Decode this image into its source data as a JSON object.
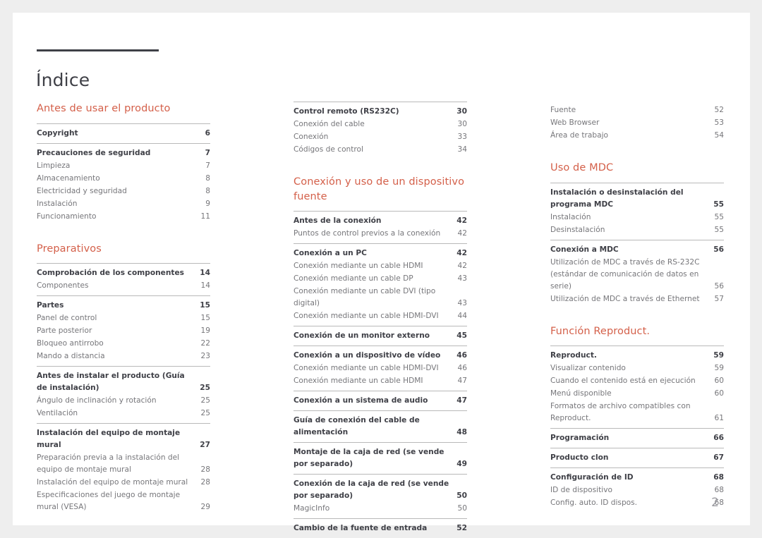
{
  "document": {
    "title": "Índice",
    "folio": "2",
    "accent_color": "#d4604a",
    "text_color": "#3f4047",
    "sub_text_color": "#76767a",
    "rule_color": "#b9b9b9",
    "page_background": "#ffffff",
    "canvas_background": "#eeeeee"
  },
  "columns": [
    {
      "name": "column-1",
      "blocks": [
        {
          "type": "heading",
          "text": "Antes de usar el producto",
          "pad_top": false
        },
        {
          "type": "group",
          "rule": true,
          "rows": [
            {
              "label": "Copyright",
              "page": "6",
              "major": true
            }
          ]
        },
        {
          "type": "group",
          "rule": true,
          "rows": [
            {
              "label": "Precauciones de seguridad",
              "page": "7",
              "major": true
            },
            {
              "label": "Limpieza",
              "page": "7",
              "major": false
            },
            {
              "label": "Almacenamiento",
              "page": "8",
              "major": false
            },
            {
              "label": "Electricidad y seguridad",
              "page": "8",
              "major": false
            },
            {
              "label": "Instalación",
              "page": "9",
              "major": false
            },
            {
              "label": "Funcionamiento",
              "page": "11",
              "major": false
            }
          ]
        },
        {
          "type": "heading",
          "text": "Preparativos",
          "pad_top": true
        },
        {
          "type": "group",
          "rule": true,
          "rows": [
            {
              "label": "Comprobación de los componentes",
              "page": "14",
              "major": true
            },
            {
              "label": "Componentes",
              "page": "14",
              "major": false
            }
          ]
        },
        {
          "type": "group",
          "rule": true,
          "rows": [
            {
              "label": "Partes",
              "page": "15",
              "major": true
            },
            {
              "label": "Panel de control",
              "page": "15",
              "major": false
            },
            {
              "label": "Parte posterior",
              "page": "19",
              "major": false
            },
            {
              "label": "Bloqueo antirrobo",
              "page": "22",
              "major": false
            },
            {
              "label": "Mando a distancia",
              "page": "23",
              "major": false
            }
          ]
        },
        {
          "type": "group",
          "rule": true,
          "rows": [
            {
              "label": "Antes de instalar el producto (Guía de instalación)",
              "page": "25",
              "major": true
            },
            {
              "label": "Ángulo de inclinación y rotación",
              "page": "25",
              "major": false
            },
            {
              "label": "Ventilación",
              "page": "25",
              "major": false
            }
          ]
        },
        {
          "type": "group",
          "rule": true,
          "rows": [
            {
              "label": "Instalación del equipo de montaje mural",
              "page": "27",
              "major": true
            },
            {
              "label": "Preparación previa a la instalación del equipo de montaje mural",
              "page": "28",
              "major": false
            },
            {
              "label": "Instalación del equipo de montaje mural",
              "page": "28",
              "major": false
            },
            {
              "label": "Especificaciones del juego de montaje mural (VESA)",
              "page": "29",
              "major": false
            }
          ]
        }
      ]
    },
    {
      "name": "column-2",
      "blocks": [
        {
          "type": "group",
          "rule": true,
          "rows": [
            {
              "label": "Control remoto (RS232C)",
              "page": "30",
              "major": true
            },
            {
              "label": "Conexión del cable",
              "page": "30",
              "major": false
            },
            {
              "label": "Conexión",
              "page": "33",
              "major": false
            },
            {
              "label": "Códigos de control",
              "page": "34",
              "major": false
            }
          ]
        },
        {
          "type": "heading",
          "text": "Conexión y uso de un dispositivo fuente",
          "pad_top": true
        },
        {
          "type": "group",
          "rule": true,
          "rows": [
            {
              "label": "Antes de la conexión",
              "page": "42",
              "major": true
            },
            {
              "label": "Puntos de control previos a la conexión",
              "page": "42",
              "major": false
            }
          ]
        },
        {
          "type": "group",
          "rule": true,
          "rows": [
            {
              "label": "Conexión a un PC",
              "page": "42",
              "major": true
            },
            {
              "label": "Conexión mediante un cable HDMI",
              "page": "42",
              "major": false
            },
            {
              "label": "Conexión mediante un cable DP",
              "page": "43",
              "major": false
            },
            {
              "label": "Conexión mediante un cable DVI (tipo digital)",
              "page": "43",
              "major": false,
              "wide": true
            },
            {
              "label": "Conexión mediante un cable HDMI-DVI",
              "page": "44",
              "major": false
            }
          ]
        },
        {
          "type": "group",
          "rule": true,
          "rows": [
            {
              "label": "Conexión de un monitor externo",
              "page": "45",
              "major": true
            }
          ]
        },
        {
          "type": "group",
          "rule": true,
          "rows": [
            {
              "label": "Conexión a un dispositivo de vídeo",
              "page": "46",
              "major": true
            },
            {
              "label": "Conexión mediante un cable HDMI-DVI",
              "page": "46",
              "major": false
            },
            {
              "label": "Conexión mediante un cable HDMI",
              "page": "47",
              "major": false
            }
          ]
        },
        {
          "type": "group",
          "rule": true,
          "rows": [
            {
              "label": "Conexión a un sistema de audio",
              "page": "47",
              "major": true
            }
          ]
        },
        {
          "type": "group",
          "rule": true,
          "rows": [
            {
              "label": "Guía de conexión del cable de alimentación",
              "page": "48",
              "major": true,
              "wide": true
            }
          ]
        },
        {
          "type": "group",
          "rule": true,
          "rows": [
            {
              "label": "Montaje de la caja de red (se vende por separado)",
              "page": "49",
              "major": true
            }
          ]
        },
        {
          "type": "group",
          "rule": true,
          "rows": [
            {
              "label": "Conexión de la caja de red (se vende por separado)",
              "page": "50",
              "major": true
            },
            {
              "label": "MagicInfo",
              "page": "50",
              "major": false
            }
          ]
        },
        {
          "type": "group",
          "rule": true,
          "rows": [
            {
              "label": "Cambio de la fuente de entrada",
              "page": "52",
              "major": true
            }
          ]
        }
      ]
    },
    {
      "name": "column-3",
      "blocks": [
        {
          "type": "group",
          "rule": false,
          "rows": [
            {
              "label": "Fuente",
              "page": "52",
              "major": false
            },
            {
              "label": "Web Browser",
              "page": "53",
              "major": false
            },
            {
              "label": "Área de trabajo",
              "page": "54",
              "major": false
            }
          ]
        },
        {
          "type": "heading",
          "text": "Uso de MDC",
          "pad_top": true
        },
        {
          "type": "group",
          "rule": true,
          "rows": [
            {
              "label": "Instalación o desinstalación del programa MDC",
              "page": "55",
              "major": true
            },
            {
              "label": "Instalación",
              "page": "55",
              "major": false
            },
            {
              "label": "Desinstalación",
              "page": "55",
              "major": false
            }
          ]
        },
        {
          "type": "group",
          "rule": true,
          "rows": [
            {
              "label": "Conexión a MDC",
              "page": "56",
              "major": true
            },
            {
              "label": "Utilización de MDC a través de RS-232C (estándar de comunicación de datos en serie)",
              "page": "56",
              "major": false
            },
            {
              "label": "Utilización de MDC a través de Ethernet",
              "page": "57",
              "major": false
            }
          ]
        },
        {
          "type": "heading",
          "text": "Función Reproduct.",
          "pad_top": true
        },
        {
          "type": "group",
          "rule": true,
          "rows": [
            {
              "label": "Reproduct.",
              "page": "59",
              "major": true
            },
            {
              "label": "Visualizar contenido",
              "page": "59",
              "major": false
            },
            {
              "label": "Cuando el contenido está en ejecución",
              "page": "60",
              "major": false
            },
            {
              "label": "Menú disponible",
              "page": "60",
              "major": false
            },
            {
              "label": "Formatos de archivo compatibles con Reproduct.",
              "page": "61",
              "major": false
            }
          ]
        },
        {
          "type": "group",
          "rule": true,
          "rows": [
            {
              "label": "Programación",
              "page": "66",
              "major": true
            }
          ]
        },
        {
          "type": "group",
          "rule": true,
          "rows": [
            {
              "label": "Producto clon",
              "page": "67",
              "major": true
            }
          ]
        },
        {
          "type": "group",
          "rule": true,
          "rows": [
            {
              "label": "Configuración de ID",
              "page": "68",
              "major": true
            },
            {
              "label": "ID de dispositivo",
              "page": "68",
              "major": false
            },
            {
              "label": "Config. auto. ID dispos.",
              "page": "68",
              "major": false
            }
          ]
        }
      ]
    }
  ]
}
